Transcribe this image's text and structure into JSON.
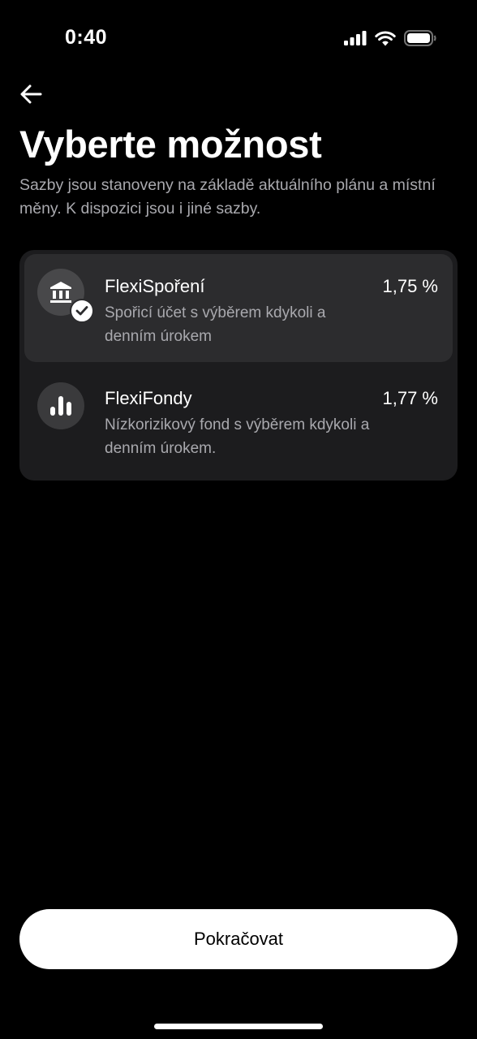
{
  "status_bar": {
    "time": "0:40"
  },
  "header": {
    "back_icon": "arrow-left-icon",
    "title": "Vyberte možnost",
    "subtitle": "Sazby jsou stanoveny na základě aktuálního plánu a místní měny. K dispozici jsou i jiné sazby."
  },
  "options": [
    {
      "title": "FlexiSpoření",
      "rate": "1,75 %",
      "description": "Spořicí účet s výběrem kdykoli a denním úrokem",
      "icon": "bank-icon",
      "selected": true
    },
    {
      "title": "FlexiFondy",
      "rate": "1,77 %",
      "description": "Nízkorizikový fond s výběrem kdykoli a denním úrokem.",
      "icon": "bar-chart-icon",
      "selected": false
    }
  ],
  "footer": {
    "continue_label": "Pokračovat"
  },
  "colors": {
    "background": "#000000",
    "card": "#1c1c1e",
    "selected_card": "#2c2c2e",
    "secondary_text": "#a9a9ae",
    "button": "#ffffff"
  }
}
